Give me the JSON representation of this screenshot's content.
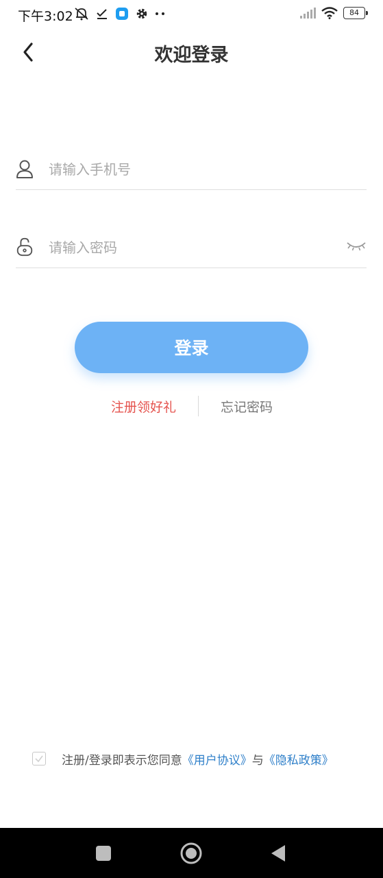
{
  "status_bar": {
    "time": "下午3:02",
    "battery": "84",
    "icons": [
      "bell-off-icon",
      "check-icon",
      "app-notification-icon",
      "gear-icon",
      "more-dots-icon",
      "signal-icon",
      "wifi-icon",
      "battery-icon"
    ]
  },
  "header": {
    "title": "欢迎登录",
    "back_icon": "chevron-left-icon"
  },
  "form": {
    "phone": {
      "placeholder": "请输入手机号",
      "value": "",
      "icon": "user-icon"
    },
    "password": {
      "placeholder": "请输入密码",
      "value": "",
      "icon": "lock-icon",
      "toggle_icon": "eye-closed-icon"
    },
    "login_label": "登录"
  },
  "links": {
    "register": "注册领好礼",
    "forgot": "忘记密码"
  },
  "agreement": {
    "checked": false,
    "prefix": "注册/登录即表示您同意",
    "user_agreement": "《用户协议》",
    "conjunction": "与",
    "privacy_policy": "《隐私政策》"
  },
  "colors": {
    "accent": "#6db2f5",
    "register_red": "#e5544f",
    "link_blue": "#2e7fc9"
  },
  "nav_bar": {
    "icons": [
      "square-icon",
      "circle-home-icon",
      "triangle-back-icon"
    ]
  }
}
